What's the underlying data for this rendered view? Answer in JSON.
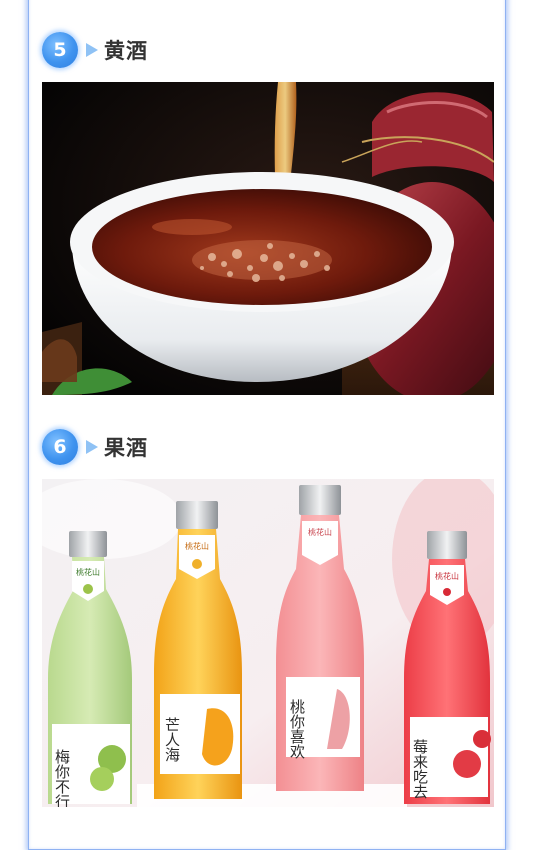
{
  "sections": [
    {
      "number": "5",
      "title": "黄酒",
      "image": "yellow-rice-wine-photo"
    },
    {
      "number": "6",
      "title": "果酒",
      "image": "fruit-wine-photo",
      "bottles": [
        {
          "brand": "桃花山",
          "label": "梅你不行"
        },
        {
          "brand": "桃花山",
          "label": "芒人海"
        },
        {
          "brand": "桃花山",
          "label": "桃你喜欢"
        },
        {
          "brand": "桃花山",
          "label": "莓来吃去"
        }
      ]
    }
  ],
  "colors": {
    "frame_border": "#8fb2f2",
    "badge": "#3f93ef",
    "arrow": "#8fc2f5",
    "title_text": "#333333"
  }
}
